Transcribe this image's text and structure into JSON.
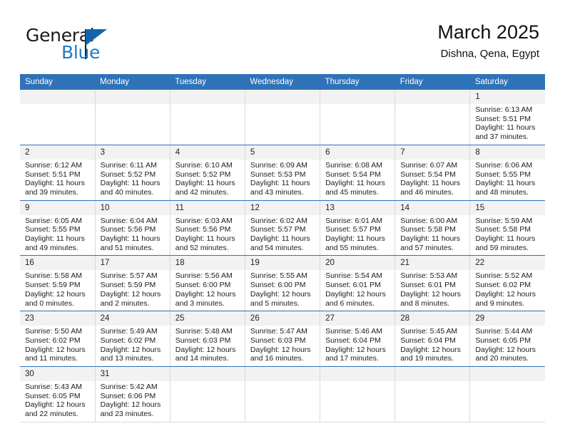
{
  "brand": {
    "name_part1": "General",
    "name_part2": "Blue",
    "flag_icon": "flag-triangle-icon",
    "accent_color": "#1f7ac4"
  },
  "header": {
    "title": "March 2025",
    "subtitle": "Dishna, Qena, Egypt"
  },
  "calendar": {
    "header_bg": "#2f72b8",
    "daynum_bg": "#f2f2f2",
    "weekdays": [
      "Sunday",
      "Monday",
      "Tuesday",
      "Wednesday",
      "Thursday",
      "Friday",
      "Saturday"
    ],
    "weeks": [
      [
        {
          "day": "",
          "blank": true
        },
        {
          "day": "",
          "blank": true
        },
        {
          "day": "",
          "blank": true
        },
        {
          "day": "",
          "blank": true
        },
        {
          "day": "",
          "blank": true
        },
        {
          "day": "",
          "blank": true
        },
        {
          "day": "1",
          "sunrise": "Sunrise: 6:13 AM",
          "sunset": "Sunset: 5:51 PM",
          "daylight": "Daylight: 11 hours and 37 minutes."
        }
      ],
      [
        {
          "day": "2",
          "sunrise": "Sunrise: 6:12 AM",
          "sunset": "Sunset: 5:51 PM",
          "daylight": "Daylight: 11 hours and 39 minutes."
        },
        {
          "day": "3",
          "sunrise": "Sunrise: 6:11 AM",
          "sunset": "Sunset: 5:52 PM",
          "daylight": "Daylight: 11 hours and 40 minutes."
        },
        {
          "day": "4",
          "sunrise": "Sunrise: 6:10 AM",
          "sunset": "Sunset: 5:52 PM",
          "daylight": "Daylight: 11 hours and 42 minutes."
        },
        {
          "day": "5",
          "sunrise": "Sunrise: 6:09 AM",
          "sunset": "Sunset: 5:53 PM",
          "daylight": "Daylight: 11 hours and 43 minutes."
        },
        {
          "day": "6",
          "sunrise": "Sunrise: 6:08 AM",
          "sunset": "Sunset: 5:54 PM",
          "daylight": "Daylight: 11 hours and 45 minutes."
        },
        {
          "day": "7",
          "sunrise": "Sunrise: 6:07 AM",
          "sunset": "Sunset: 5:54 PM",
          "daylight": "Daylight: 11 hours and 46 minutes."
        },
        {
          "day": "8",
          "sunrise": "Sunrise: 6:06 AM",
          "sunset": "Sunset: 5:55 PM",
          "daylight": "Daylight: 11 hours and 48 minutes."
        }
      ],
      [
        {
          "day": "9",
          "sunrise": "Sunrise: 6:05 AM",
          "sunset": "Sunset: 5:55 PM",
          "daylight": "Daylight: 11 hours and 49 minutes."
        },
        {
          "day": "10",
          "sunrise": "Sunrise: 6:04 AM",
          "sunset": "Sunset: 5:56 PM",
          "daylight": "Daylight: 11 hours and 51 minutes."
        },
        {
          "day": "11",
          "sunrise": "Sunrise: 6:03 AM",
          "sunset": "Sunset: 5:56 PM",
          "daylight": "Daylight: 11 hours and 52 minutes."
        },
        {
          "day": "12",
          "sunrise": "Sunrise: 6:02 AM",
          "sunset": "Sunset: 5:57 PM",
          "daylight": "Daylight: 11 hours and 54 minutes."
        },
        {
          "day": "13",
          "sunrise": "Sunrise: 6:01 AM",
          "sunset": "Sunset: 5:57 PM",
          "daylight": "Daylight: 11 hours and 55 minutes."
        },
        {
          "day": "14",
          "sunrise": "Sunrise: 6:00 AM",
          "sunset": "Sunset: 5:58 PM",
          "daylight": "Daylight: 11 hours and 57 minutes."
        },
        {
          "day": "15",
          "sunrise": "Sunrise: 5:59 AM",
          "sunset": "Sunset: 5:58 PM",
          "daylight": "Daylight: 11 hours and 59 minutes."
        }
      ],
      [
        {
          "day": "16",
          "sunrise": "Sunrise: 5:58 AM",
          "sunset": "Sunset: 5:59 PM",
          "daylight": "Daylight: 12 hours and 0 minutes."
        },
        {
          "day": "17",
          "sunrise": "Sunrise: 5:57 AM",
          "sunset": "Sunset: 5:59 PM",
          "daylight": "Daylight: 12 hours and 2 minutes."
        },
        {
          "day": "18",
          "sunrise": "Sunrise: 5:56 AM",
          "sunset": "Sunset: 6:00 PM",
          "daylight": "Daylight: 12 hours and 3 minutes."
        },
        {
          "day": "19",
          "sunrise": "Sunrise: 5:55 AM",
          "sunset": "Sunset: 6:00 PM",
          "daylight": "Daylight: 12 hours and 5 minutes."
        },
        {
          "day": "20",
          "sunrise": "Sunrise: 5:54 AM",
          "sunset": "Sunset: 6:01 PM",
          "daylight": "Daylight: 12 hours and 6 minutes."
        },
        {
          "day": "21",
          "sunrise": "Sunrise: 5:53 AM",
          "sunset": "Sunset: 6:01 PM",
          "daylight": "Daylight: 12 hours and 8 minutes."
        },
        {
          "day": "22",
          "sunrise": "Sunrise: 5:52 AM",
          "sunset": "Sunset: 6:02 PM",
          "daylight": "Daylight: 12 hours and 9 minutes."
        }
      ],
      [
        {
          "day": "23",
          "sunrise": "Sunrise: 5:50 AM",
          "sunset": "Sunset: 6:02 PM",
          "daylight": "Daylight: 12 hours and 11 minutes."
        },
        {
          "day": "24",
          "sunrise": "Sunrise: 5:49 AM",
          "sunset": "Sunset: 6:02 PM",
          "daylight": "Daylight: 12 hours and 13 minutes."
        },
        {
          "day": "25",
          "sunrise": "Sunrise: 5:48 AM",
          "sunset": "Sunset: 6:03 PM",
          "daylight": "Daylight: 12 hours and 14 minutes."
        },
        {
          "day": "26",
          "sunrise": "Sunrise: 5:47 AM",
          "sunset": "Sunset: 6:03 PM",
          "daylight": "Daylight: 12 hours and 16 minutes."
        },
        {
          "day": "27",
          "sunrise": "Sunrise: 5:46 AM",
          "sunset": "Sunset: 6:04 PM",
          "daylight": "Daylight: 12 hours and 17 minutes."
        },
        {
          "day": "28",
          "sunrise": "Sunrise: 5:45 AM",
          "sunset": "Sunset: 6:04 PM",
          "daylight": "Daylight: 12 hours and 19 minutes."
        },
        {
          "day": "29",
          "sunrise": "Sunrise: 5:44 AM",
          "sunset": "Sunset: 6:05 PM",
          "daylight": "Daylight: 12 hours and 20 minutes."
        }
      ],
      [
        {
          "day": "30",
          "sunrise": "Sunrise: 5:43 AM",
          "sunset": "Sunset: 6:05 PM",
          "daylight": "Daylight: 12 hours and 22 minutes."
        },
        {
          "day": "31",
          "sunrise": "Sunrise: 5:42 AM",
          "sunset": "Sunset: 6:06 PM",
          "daylight": "Daylight: 12 hours and 23 minutes."
        },
        {
          "day": "",
          "blank": true
        },
        {
          "day": "",
          "blank": true
        },
        {
          "day": "",
          "blank": true
        },
        {
          "day": "",
          "blank": true
        },
        {
          "day": "",
          "blank": true
        }
      ]
    ]
  }
}
